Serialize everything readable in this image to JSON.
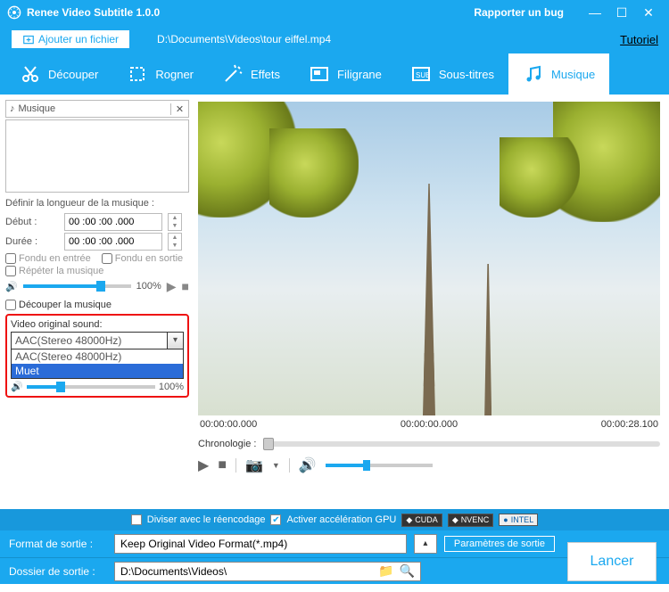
{
  "titlebar": {
    "app_title": "Renee Video Subtitle 1.0.0",
    "bug_report": "Rapporter un bug"
  },
  "toprow": {
    "add_file": "Ajouter un fichier",
    "filepath": "D:\\Documents\\Videos\\tour eiffel.mp4",
    "tutorial": "Tutoriel"
  },
  "tabs": {
    "cut": "Découper",
    "crop": "Rogner",
    "effects": "Effets",
    "watermark": "Filigrane",
    "subtitles": "Sous-titres",
    "music": "Musique"
  },
  "side": {
    "music_header": "Musique",
    "length_label": "Définir la longueur de la musique :",
    "start_label": "Début :",
    "start_val": "00 :00 :00 .000",
    "duration_label": "Durée :",
    "duration_val": "00 :00 :00 .000",
    "fade_in": "Fondu en entrée",
    "fade_out": "Fondu en sortie",
    "repeat": "Répéter la musique",
    "vol_pct": "100%",
    "cut_music": "Découper la musique",
    "orig_sound_label": "Video original sound:",
    "combo_value": "AAC(Stereo 48000Hz)",
    "opt1": "AAC(Stereo 48000Hz)",
    "opt2": "Muet",
    "orig_vol_pct": "100%"
  },
  "preview": {
    "t_start": "00:00:00.000",
    "t_mid": "00:00:00.000",
    "t_end": "00:00:28.100",
    "chronology": "Chronologie :"
  },
  "options": {
    "split_reencode": "Diviser avec le réencodage",
    "gpu_accel": "Activer accélération GPU",
    "cuda": "CUDA",
    "nvenc": "NVENC",
    "intel": "INTEL"
  },
  "output": {
    "format_label": "Format de sortie :",
    "format_value": "Keep Original Video Format(*.mp4)",
    "params": "Paramètres de sortie",
    "folder_label": "Dossier de sortie :",
    "folder_value": "D:\\Documents\\Videos\\",
    "launch": "Lancer"
  }
}
